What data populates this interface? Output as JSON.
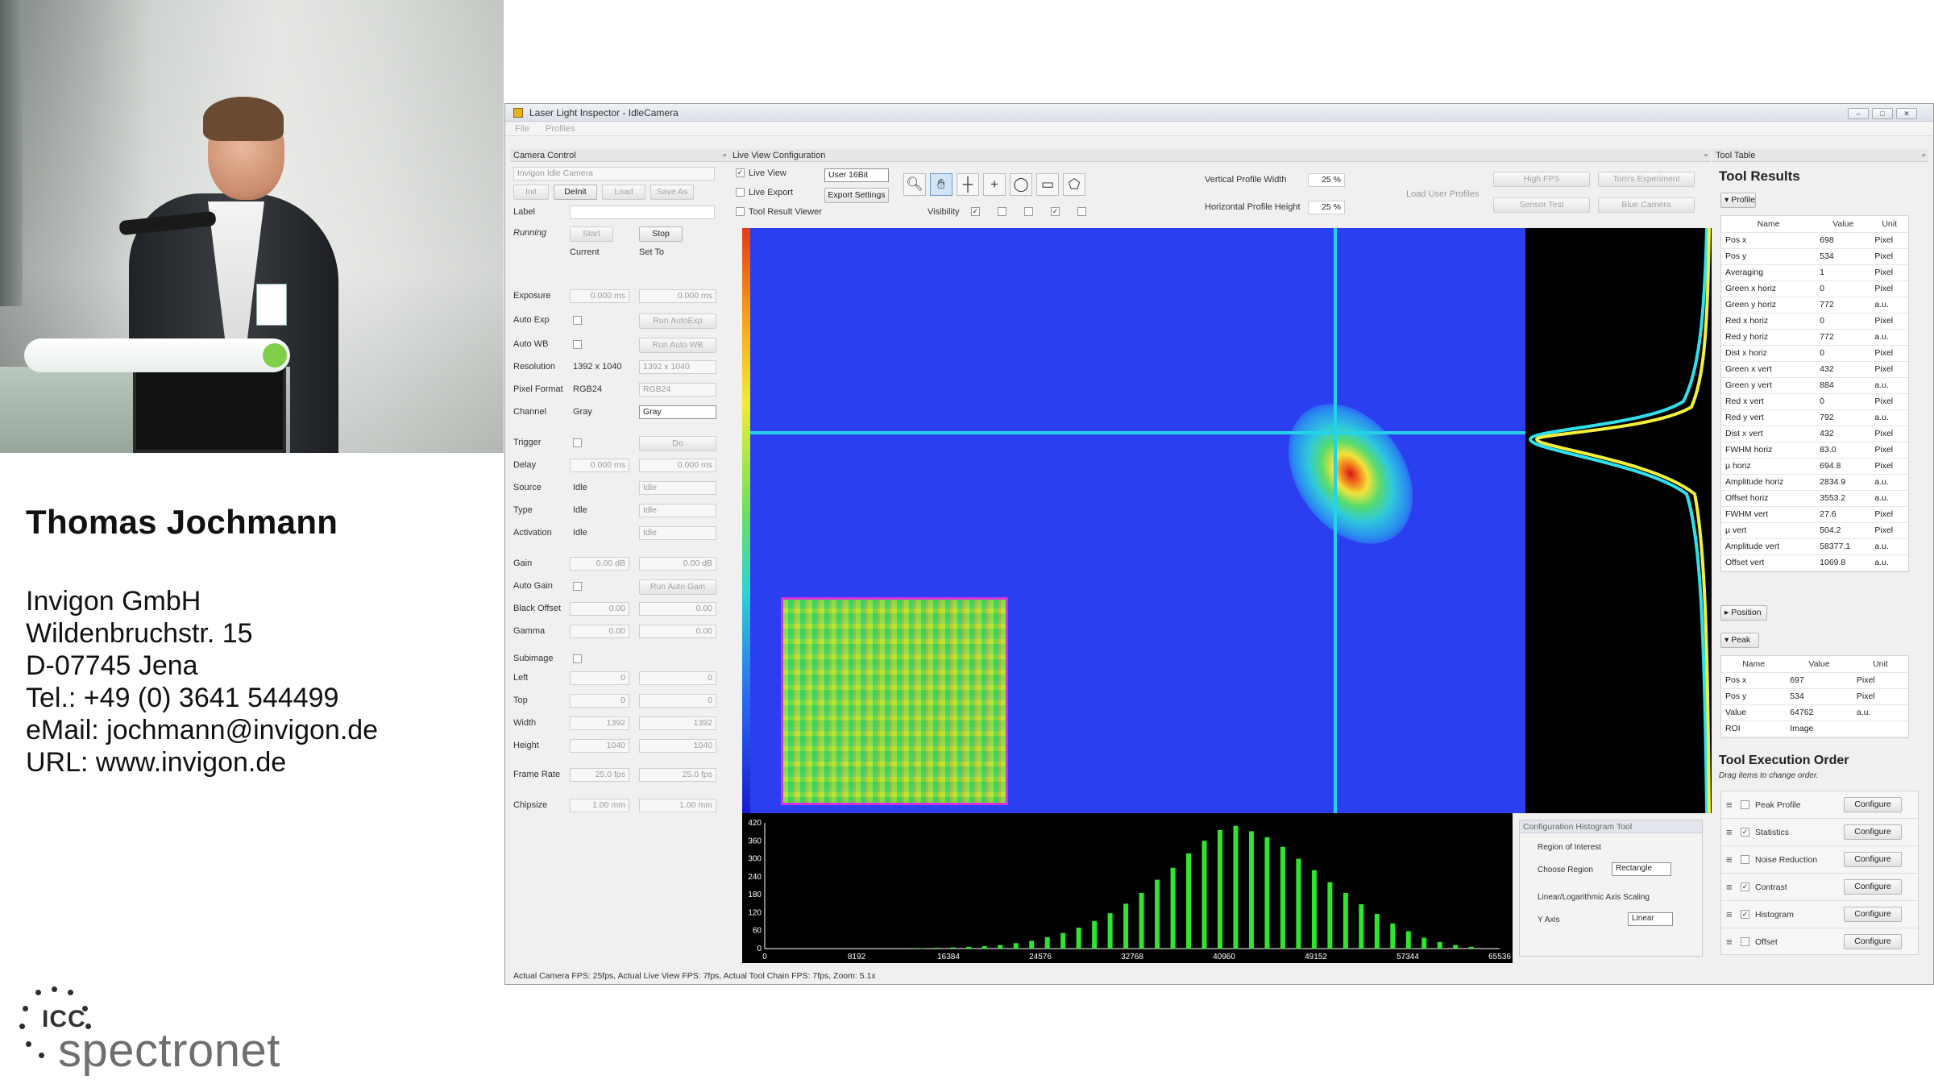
{
  "presenter": {
    "name": "Thomas Jochmann",
    "company": "Invigon GmbH",
    "street": "Wildenbruchstr. 15",
    "city": "D-07745 Jena",
    "tel": "Tel.: +49 (0) 3641 544499",
    "email": "eMail: jochmann@invigon.de",
    "url": "URL: www.invigon.de"
  },
  "logo": {
    "top": "ICC",
    "bottom": "spectronet"
  },
  "window": {
    "title": "Laser Light Inspector - IdleCamera",
    "menu": [
      "File",
      "Profiles"
    ],
    "controls": [
      "minimize",
      "maximize",
      "close"
    ]
  },
  "camera_control": {
    "header": "Camera Control",
    "camera_select": "Invigon Idle Camera",
    "buttons": {
      "init": "Init",
      "deinit": "DeInit",
      "load": "Load",
      "save_as": "Save As"
    },
    "label_caption": "Label",
    "running_caption": "Running",
    "start": "Start",
    "stop": "Stop",
    "col_current": "Current",
    "col_set_to": "Set To",
    "rows": [
      {
        "label": "Exposure",
        "current": "0.000 ms",
        "set": "0.000 ms"
      },
      {
        "label": "Auto Exp",
        "current": "",
        "set": "Run AutoExp"
      },
      {
        "label": "Auto WB",
        "current": "",
        "set": "Run Auto WB"
      },
      {
        "label": "Resolution",
        "current": "1392 x 1040",
        "set": "1392 x 1040"
      },
      {
        "label": "Pixel Format",
        "current": "RGB24",
        "set": "RGB24"
      },
      {
        "label": "Channel",
        "current": "Gray",
        "set": "Gray"
      },
      {
        "label": "Trigger",
        "current": "",
        "set": "Do"
      },
      {
        "label": "Delay",
        "current": "0.000 ms",
        "set": "0.000 ms"
      },
      {
        "label": "Source",
        "current": "Idle",
        "set": "Idle"
      },
      {
        "label": "Type",
        "current": "Idle",
        "set": "Idle"
      },
      {
        "label": "Activation",
        "current": "Idle",
        "set": "Idle"
      },
      {
        "label": "Gain",
        "current": "0.00 dB",
        "set": "0.00 dB"
      },
      {
        "label": "Auto Gain",
        "current": "",
        "set": "Run Auto Gain"
      },
      {
        "label": "Black Offset",
        "current": "0.00",
        "set": "0.00"
      },
      {
        "label": "Gamma",
        "current": "0.00",
        "set": "0.00"
      },
      {
        "label": "Subimage",
        "current": "",
        "set": ""
      },
      {
        "label": "Left",
        "current": "0",
        "set": "0"
      },
      {
        "label": "Top",
        "current": "0",
        "set": "0"
      },
      {
        "label": "Width",
        "current": "1392",
        "set": "1392"
      },
      {
        "label": "Height",
        "current": "1040",
        "set": "1040"
      },
      {
        "label": "Frame Rate",
        "current": "25.0 fps",
        "set": "25.0 fps"
      },
      {
        "label": "Chipsize",
        "current": "1.00 mm",
        "set": "1.00 mm"
      }
    ]
  },
  "live_view": {
    "header": "Live View Configuration",
    "checks": [
      {
        "label": "Live View",
        "checked": true
      },
      {
        "label": "Live Export",
        "checked": false
      },
      {
        "label": "Tool Result Viewer",
        "checked": false
      }
    ],
    "bit_mode": "User 16Bit",
    "export_settings": "Export Settings",
    "visibility_caption": "Visibility",
    "visibility": [
      true,
      false,
      false,
      true,
      false
    ],
    "tools": [
      "zoom-icon",
      "pan-hand-icon",
      "crosshair-line-icon",
      "plus-icon",
      "ellipse-icon",
      "rectangle-icon",
      "polygon-icon"
    ],
    "vertical_profile_width_label": "Vertical Profile Width",
    "vertical_profile_width": "25 %",
    "horizontal_profile_height_label": "Horizontal Profile Height",
    "horizontal_profile_height": "25 %",
    "load_user_profiles": "Load User Profiles",
    "profiles": [
      "High FPS",
      "Tom's Experiment",
      "Sensor Test",
      "Blue Camera"
    ]
  },
  "histogram_tool": {
    "header": "Configuration Histogram Tool",
    "region_caption": "Region of Interest",
    "choose_region": "Choose Region",
    "region_value": "Rectangle",
    "scaling_caption": "Linear/Logarithmic Axis Scaling",
    "y_axis": "Y Axis",
    "y_axis_value": "Linear"
  },
  "chart_data": {
    "type": "bar",
    "yticks": [
      "420",
      "360",
      "300",
      "240",
      "180",
      "120",
      "60",
      "0"
    ],
    "xticks": [
      "0",
      "8192",
      "16384",
      "24576",
      "32768",
      "40960",
      "49152",
      "57344",
      "65536"
    ],
    "xlim": [
      0,
      65536
    ],
    "ylim": [
      0,
      420
    ],
    "bar_color": "#2ee62e",
    "x": [
      14000,
      15400,
      16800,
      18200,
      19600,
      21000,
      22400,
      23800,
      25200,
      26600,
      28000,
      29400,
      30800,
      32200,
      33600,
      35000,
      36400,
      37800,
      39200,
      40600,
      42000,
      43400,
      44800,
      46200,
      47600,
      49000,
      50400,
      51800,
      53200,
      54600,
      56000,
      57400,
      58800,
      60200,
      61600,
      63000
    ],
    "values": [
      2,
      3,
      4,
      6,
      8,
      12,
      18,
      26,
      38,
      52,
      70,
      92,
      118,
      150,
      186,
      230,
      270,
      318,
      360,
      396,
      410,
      392,
      372,
      340,
      300,
      262,
      222,
      186,
      148,
      116,
      84,
      58,
      36,
      22,
      12,
      6
    ]
  },
  "tool_table": {
    "header": "Tool Table",
    "title": "Tool Results",
    "profile_section": "Profile",
    "columns": [
      "Name",
      "Value",
      "Unit"
    ],
    "profile_rows": [
      [
        "Pos x",
        "698",
        "Pixel"
      ],
      [
        "Pos y",
        "534",
        "Pixel"
      ],
      [
        "Averaging",
        "1",
        "Pixel"
      ],
      [
        "Green x horiz",
        "0",
        "Pixel"
      ],
      [
        "Green y horiz",
        "772",
        "a.u."
      ],
      [
        "Red x horiz",
        "0",
        "Pixel"
      ],
      [
        "Red y horiz",
        "772",
        "a.u."
      ],
      [
        "Dist x horiz",
        "0",
        "Pixel"
      ],
      [
        "Green x vert",
        "432",
        "Pixel"
      ],
      [
        "Green y vert",
        "884",
        "a.u."
      ],
      [
        "Red x vert",
        "0",
        "Pixel"
      ],
      [
        "Red y vert",
        "792",
        "a.u."
      ],
      [
        "Dist x vert",
        "432",
        "Pixel"
      ],
      [
        "FWHM horiz",
        "83.0",
        "Pixel"
      ],
      [
        "μ horiz",
        "694.8",
        "Pixel"
      ],
      [
        "Amplitude horiz",
        "2834.9",
        "a.u."
      ],
      [
        "Offset horiz",
        "3553.2",
        "a.u."
      ],
      [
        "FWHM vert",
        "27.6",
        "Pixel"
      ],
      [
        "μ vert",
        "504.2",
        "Pixel"
      ],
      [
        "Amplitude vert",
        "58377.1",
        "a.u."
      ],
      [
        "Offset vert",
        "1069.8",
        "a.u."
      ]
    ],
    "position_section": "Position",
    "peak_section": "Peak",
    "peak_rows": [
      [
        "Pos x",
        "697",
        "Pixel"
      ],
      [
        "Pos y",
        "534",
        "Pixel"
      ],
      [
        "Value",
        "64762",
        "a.u."
      ],
      [
        "ROI",
        "Image",
        ""
      ]
    ],
    "exec_title": "Tool Execution Order",
    "exec_hint": "Drag items to change order.",
    "exec_items": [
      {
        "label": "Peak Profile",
        "checked": false,
        "button": "Configure"
      },
      {
        "label": "Statistics",
        "checked": true,
        "button": "Configure"
      },
      {
        "label": "Noise Reduction",
        "checked": false,
        "button": "Configure"
      },
      {
        "label": "Contrast",
        "checked": true,
        "button": "Configure"
      },
      {
        "label": "Histogram",
        "checked": true,
        "button": "Configure"
      },
      {
        "label": "Offset",
        "checked": false,
        "button": "Configure"
      }
    ]
  },
  "status_bar": "Actual Camera FPS: 25fps, Actual Live View FPS: 7fps, Actual Tool Chain FPS: 7fps, Zoom: 5.1x"
}
